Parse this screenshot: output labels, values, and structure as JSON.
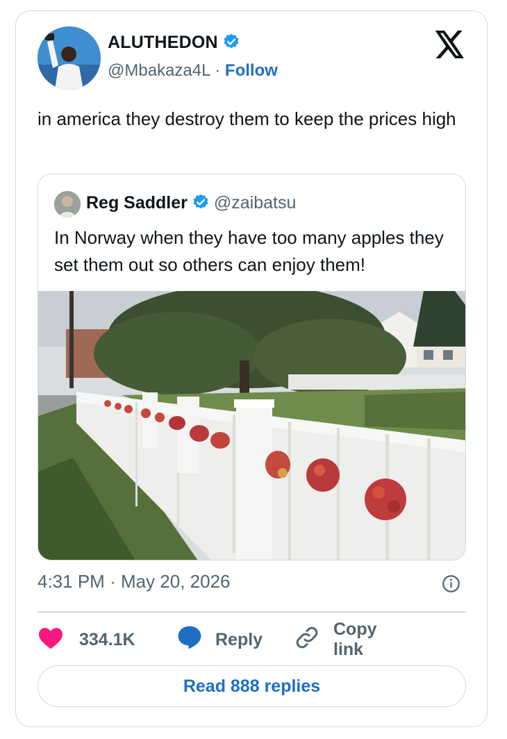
{
  "author": {
    "name": "ALUTHEDON",
    "handle": "@Mbakaza4L",
    "separator": "·",
    "follow_label": "Follow",
    "verified": true
  },
  "tweet": {
    "text": "in america they destroy them to keep the prices high"
  },
  "quoted": {
    "name": "Reg Saddler",
    "handle": "@zaibatsu",
    "verified": true,
    "text": "In Norway when they have too many apples they set them out so others can enjoy them!"
  },
  "meta": {
    "time": "4:31 PM",
    "separator": "·",
    "date": "May 20, 2026"
  },
  "actions": {
    "likes": "334.1K",
    "reply_label": "Reply",
    "copy_label": "Copy link"
  },
  "read_replies_label": "Read 888 replies",
  "colors": {
    "accent": "#1d6fc4",
    "verified": "#1d9bf0",
    "like": "#f91880",
    "muted": "#536471",
    "border": "#cfd9de"
  },
  "icons": [
    "verified-badge-icon",
    "x-logo-icon",
    "info-icon",
    "heart-icon",
    "reply-bubble-icon",
    "link-icon"
  ]
}
